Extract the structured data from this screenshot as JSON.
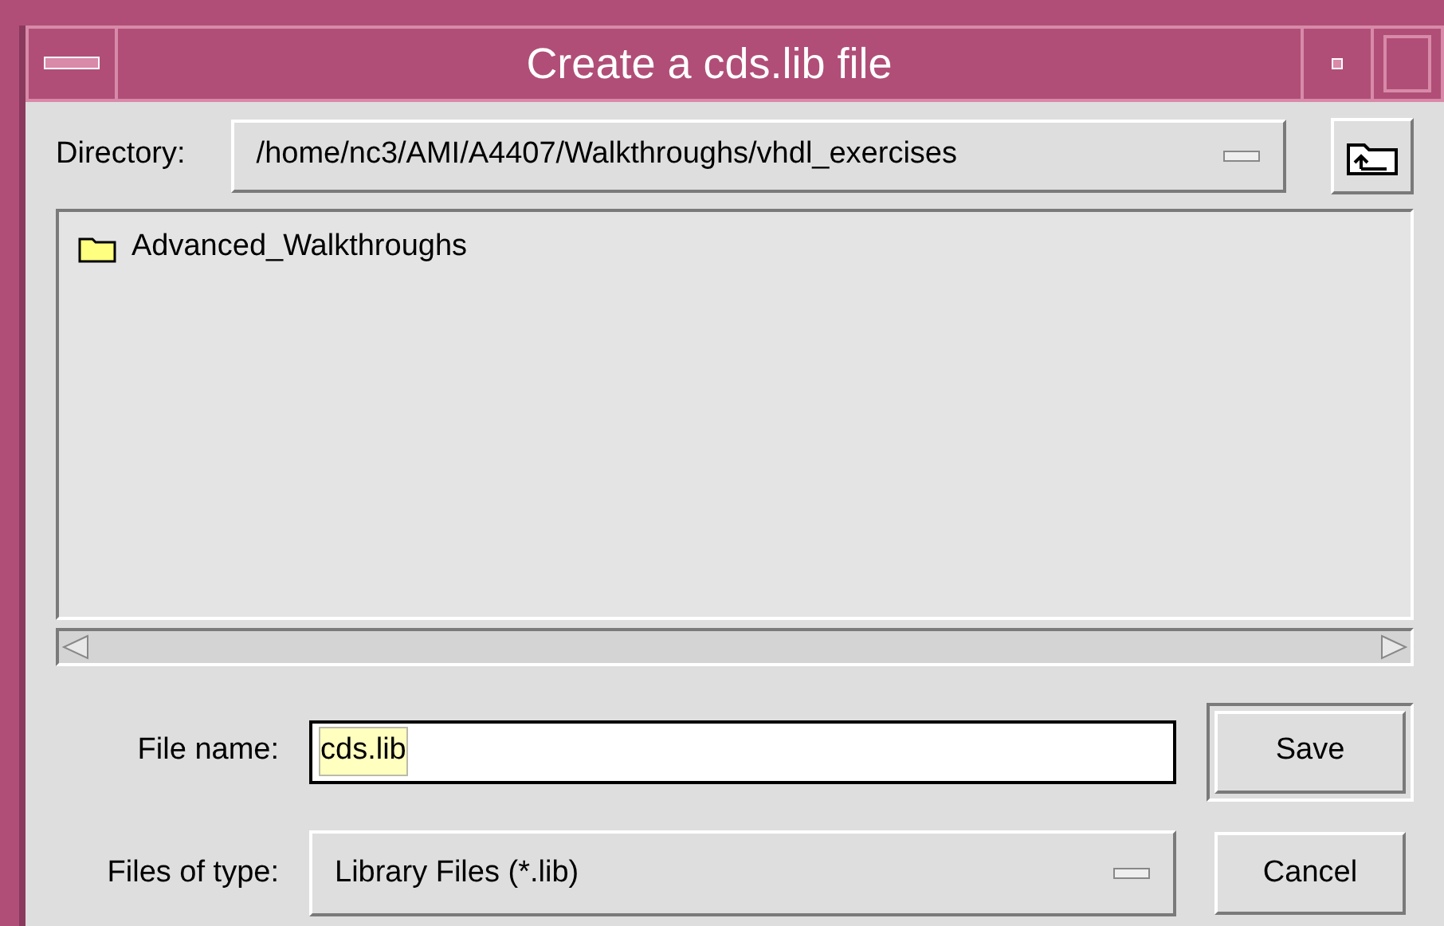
{
  "window": {
    "title": "Create a cds.lib file"
  },
  "directory": {
    "label": "Directory:",
    "value": "/home/nc3/AMI/A4407/Walkthroughs/vhdl_exercises"
  },
  "files": [
    {
      "name": "Advanced_Walkthroughs",
      "kind": "folder"
    }
  ],
  "file_name": {
    "label": "File name:",
    "value": "cds.lib"
  },
  "files_of_type": {
    "label": "Files of type:",
    "value": "Library Files (*.lib)"
  },
  "buttons": [
    {
      "label": "Save",
      "default": true
    },
    {
      "label": "Cancel",
      "default": false
    }
  ]
}
